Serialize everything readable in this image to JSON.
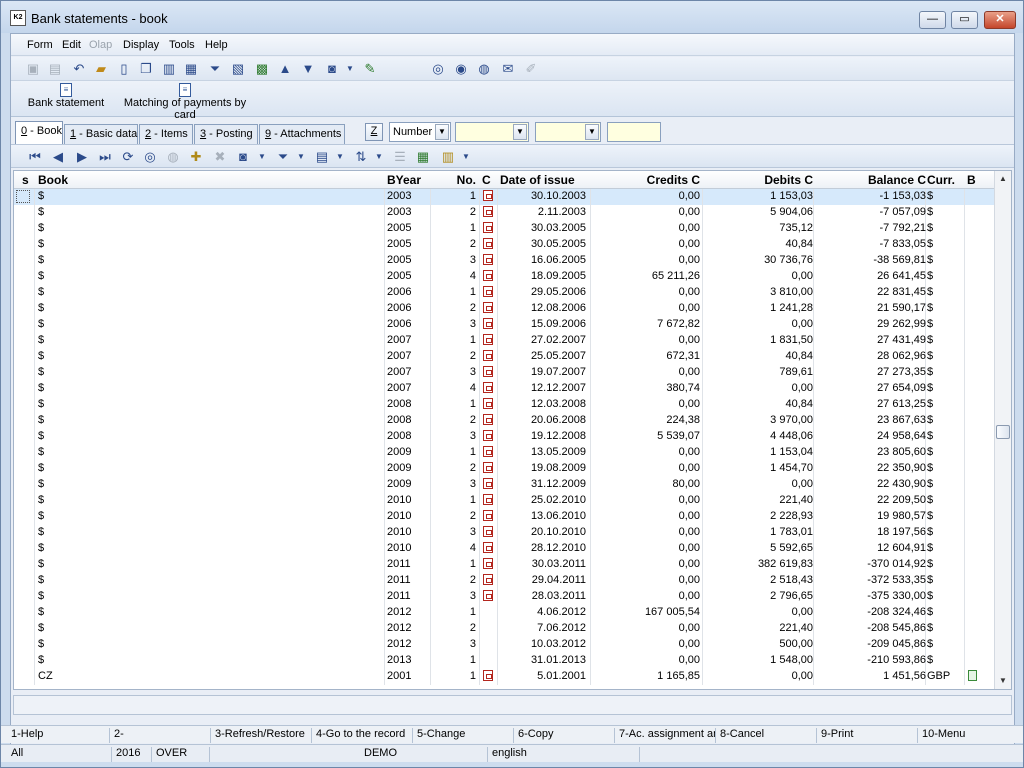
{
  "window": {
    "title": "Bank statements - book",
    "app_icon": "K2"
  },
  "window_buttons": {
    "minimize": "—",
    "maximize": "▭",
    "close": "✕"
  },
  "menu": [
    "Form",
    "Edit",
    "Olap",
    "Display",
    "Tools",
    "Help"
  ],
  "menu_disabled": [
    "Olap"
  ],
  "ribbon": {
    "bank_statement": "Bank statement",
    "matching": "Matching of payments by card"
  },
  "tabs": [
    {
      "key": "0",
      "label": " - Book"
    },
    {
      "key": "1",
      "label": " - Basic data"
    },
    {
      "key": "2",
      "label": " - Items"
    },
    {
      "key": "3",
      "label": " - Posting"
    },
    {
      "key": "9",
      "label": " - Attachments"
    }
  ],
  "filter": {
    "z_label": "Z",
    "sort_by": "Number"
  },
  "columns": [
    "s",
    "Book",
    "BYear",
    "No.",
    "C",
    "Date of issue",
    "Credits C",
    "Debits C",
    "Balance C",
    "Curr.",
    "B"
  ],
  "rows": [
    {
      "book": "$",
      "year": "2003",
      "no": "1",
      "doc": true,
      "date": "30.10.2003",
      "credits": "0,00",
      "debits": "1 153,03",
      "balance": "-1 153,03",
      "curr": "$"
    },
    {
      "book": "$",
      "year": "2003",
      "no": "2",
      "doc": true,
      "date": "2.11.2003",
      "credits": "0,00",
      "debits": "5 904,06",
      "balance": "-7 057,09",
      "curr": "$"
    },
    {
      "book": "$",
      "year": "2005",
      "no": "1",
      "doc": true,
      "date": "30.03.2005",
      "credits": "0,00",
      "debits": "735,12",
      "balance": "-7 792,21",
      "curr": "$"
    },
    {
      "book": "$",
      "year": "2005",
      "no": "2",
      "doc": true,
      "date": "30.05.2005",
      "credits": "0,00",
      "debits": "40,84",
      "balance": "-7 833,05",
      "curr": "$"
    },
    {
      "book": "$",
      "year": "2005",
      "no": "3",
      "doc": true,
      "date": "16.06.2005",
      "credits": "0,00",
      "debits": "30 736,76",
      "balance": "-38 569,81",
      "curr": "$"
    },
    {
      "book": "$",
      "year": "2005",
      "no": "4",
      "doc": true,
      "date": "18.09.2005",
      "credits": "65 211,26",
      "debits": "0,00",
      "balance": "26 641,45",
      "curr": "$"
    },
    {
      "book": "$",
      "year": "2006",
      "no": "1",
      "doc": true,
      "date": "29.05.2006",
      "credits": "0,00",
      "debits": "3 810,00",
      "balance": "22 831,45",
      "curr": "$"
    },
    {
      "book": "$",
      "year": "2006",
      "no": "2",
      "doc": true,
      "date": "12.08.2006",
      "credits": "0,00",
      "debits": "1 241,28",
      "balance": "21 590,17",
      "curr": "$"
    },
    {
      "book": "$",
      "year": "2006",
      "no": "3",
      "doc": true,
      "date": "15.09.2006",
      "credits": "7 672,82",
      "debits": "0,00",
      "balance": "29 262,99",
      "curr": "$"
    },
    {
      "book": "$",
      "year": "2007",
      "no": "1",
      "doc": true,
      "date": "27.02.2007",
      "credits": "0,00",
      "debits": "1 831,50",
      "balance": "27 431,49",
      "curr": "$"
    },
    {
      "book": "$",
      "year": "2007",
      "no": "2",
      "doc": true,
      "date": "25.05.2007",
      "credits": "672,31",
      "debits": "40,84",
      "balance": "28 062,96",
      "curr": "$"
    },
    {
      "book": "$",
      "year": "2007",
      "no": "3",
      "doc": true,
      "date": "19.07.2007",
      "credits": "0,00",
      "debits": "789,61",
      "balance": "27 273,35",
      "curr": "$"
    },
    {
      "book": "$",
      "year": "2007",
      "no": "4",
      "doc": true,
      "date": "12.12.2007",
      "credits": "380,74",
      "debits": "0,00",
      "balance": "27 654,09",
      "curr": "$"
    },
    {
      "book": "$",
      "year": "2008",
      "no": "1",
      "doc": true,
      "date": "12.03.2008",
      "credits": "0,00",
      "debits": "40,84",
      "balance": "27 613,25",
      "curr": "$"
    },
    {
      "book": "$",
      "year": "2008",
      "no": "2",
      "doc": true,
      "date": "20.06.2008",
      "credits": "224,38",
      "debits": "3 970,00",
      "balance": "23 867,63",
      "curr": "$"
    },
    {
      "book": "$",
      "year": "2008",
      "no": "3",
      "doc": true,
      "date": "19.12.2008",
      "credits": "5 539,07",
      "debits": "4 448,06",
      "balance": "24 958,64",
      "curr": "$"
    },
    {
      "book": "$",
      "year": "2009",
      "no": "1",
      "doc": true,
      "date": "13.05.2009",
      "credits": "0,00",
      "debits": "1 153,04",
      "balance": "23 805,60",
      "curr": "$"
    },
    {
      "book": "$",
      "year": "2009",
      "no": "2",
      "doc": true,
      "date": "19.08.2009",
      "credits": "0,00",
      "debits": "1 454,70",
      "balance": "22 350,90",
      "curr": "$"
    },
    {
      "book": "$",
      "year": "2009",
      "no": "3",
      "doc": true,
      "date": "31.12.2009",
      "credits": "80,00",
      "debits": "0,00",
      "balance": "22 430,90",
      "curr": "$"
    },
    {
      "book": "$",
      "year": "2010",
      "no": "1",
      "doc": true,
      "date": "25.02.2010",
      "credits": "0,00",
      "debits": "221,40",
      "balance": "22 209,50",
      "curr": "$"
    },
    {
      "book": "$",
      "year": "2010",
      "no": "2",
      "doc": true,
      "date": "13.06.2010",
      "credits": "0,00",
      "debits": "2 228,93",
      "balance": "19 980,57",
      "curr": "$"
    },
    {
      "book": "$",
      "year": "2010",
      "no": "3",
      "doc": true,
      "date": "20.10.2010",
      "credits": "0,00",
      "debits": "1 783,01",
      "balance": "18 197,56",
      "curr": "$"
    },
    {
      "book": "$",
      "year": "2010",
      "no": "4",
      "doc": true,
      "date": "28.12.2010",
      "credits": "0,00",
      "debits": "5 592,65",
      "balance": "12 604,91",
      "curr": "$"
    },
    {
      "book": "$",
      "year": "2011",
      "no": "1",
      "doc": true,
      "date": "30.03.2011",
      "credits": "0,00",
      "debits": "382 619,83",
      "balance": "-370 014,92",
      "curr": "$"
    },
    {
      "book": "$",
      "year": "2011",
      "no": "2",
      "doc": true,
      "date": "29.04.2011",
      "credits": "0,00",
      "debits": "2 518,43",
      "balance": "-372 533,35",
      "curr": "$"
    },
    {
      "book": "$",
      "year": "2011",
      "no": "3",
      "doc": true,
      "date": "28.03.2011",
      "credits": "0,00",
      "debits": "2 796,65",
      "balance": "-375 330,00",
      "curr": "$"
    },
    {
      "book": "$",
      "year": "2012",
      "no": "1",
      "doc": false,
      "date": "4.06.2012",
      "credits": "167 005,54",
      "debits": "0,00",
      "balance": "-208 324,46",
      "curr": "$"
    },
    {
      "book": "$",
      "year": "2012",
      "no": "2",
      "doc": false,
      "date": "7.06.2012",
      "credits": "0,00",
      "debits": "221,40",
      "balance": "-208 545,86",
      "curr": "$"
    },
    {
      "book": "$",
      "year": "2012",
      "no": "3",
      "doc": false,
      "date": "10.03.2012",
      "credits": "0,00",
      "debits": "500,00",
      "balance": "-209 045,86",
      "curr": "$"
    },
    {
      "book": "$",
      "year": "2013",
      "no": "1",
      "doc": false,
      "date": "31.01.2013",
      "credits": "0,00",
      "debits": "1 548,00",
      "balance": "-210 593,86",
      "curr": "$"
    },
    {
      "book": "CZ",
      "year": "2001",
      "no": "1",
      "doc": true,
      "date": "5.01.2001",
      "credits": "1 165,85",
      "debits": "0,00",
      "balance": "1 451,56",
      "curr": "GBP",
      "calc": true
    }
  ],
  "fkeys": [
    "1-Help",
    "2-",
    "3-Refresh/Restore",
    "4-Go to the record",
    "5-Change",
    "6-Copy",
    "7-Ac. assignment and",
    "8-Cancel",
    "9-Print",
    "10-Menu"
  ],
  "status": {
    "filter": "All",
    "period": "2016",
    "mode": "OVER",
    "database": "DEMO",
    "language": "english"
  },
  "colors": {
    "selected_row": "#d6e9fb",
    "doc_icon": "#b3261e"
  }
}
